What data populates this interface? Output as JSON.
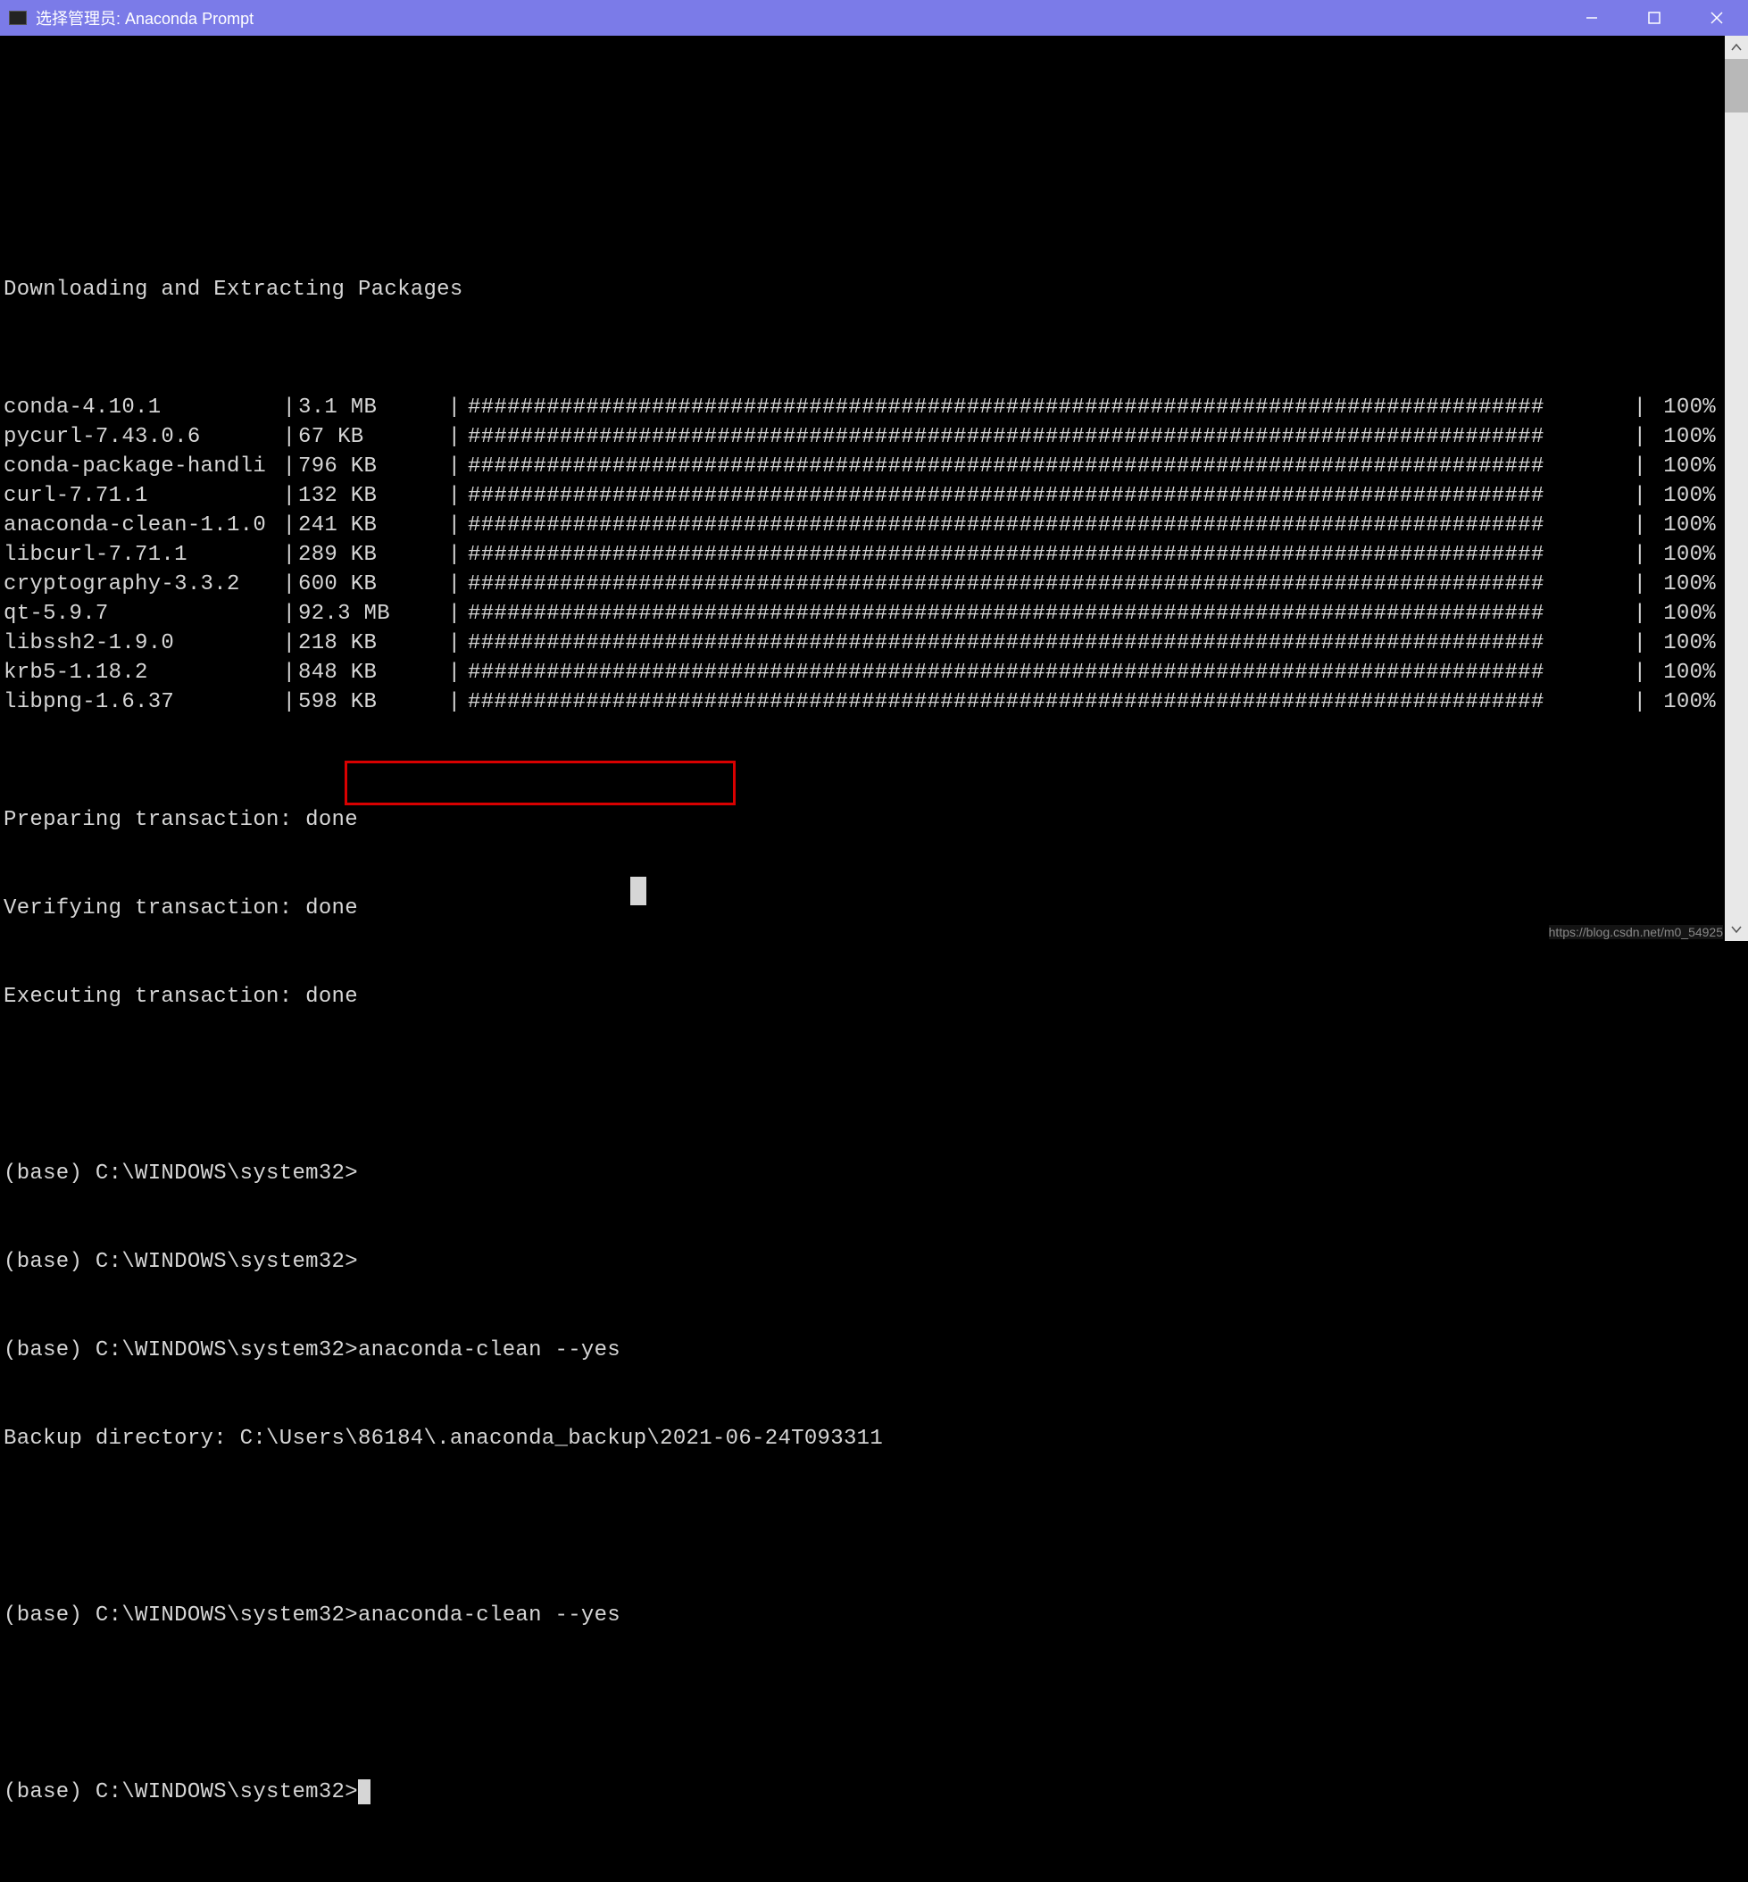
{
  "window": {
    "title": "选择管理员: Anaconda Prompt"
  },
  "header": "Downloading and Extracting Packages",
  "packages": [
    {
      "name": "conda-4.10.1",
      "size": "3.1 MB",
      "pct": "100%"
    },
    {
      "name": "pycurl-7.43.0.6",
      "size": "67 KB",
      "pct": "100%"
    },
    {
      "name": "conda-package-handli",
      "size": "796 KB",
      "pct": "100%"
    },
    {
      "name": "curl-7.71.1",
      "size": "132 KB",
      "pct": "100%"
    },
    {
      "name": "anaconda-clean-1.1.0",
      "size": "241 KB",
      "pct": "100%"
    },
    {
      "name": "libcurl-7.71.1",
      "size": "289 KB",
      "pct": "100%"
    },
    {
      "name": "cryptography-3.3.2",
      "size": "600 KB",
      "pct": "100%"
    },
    {
      "name": "qt-5.9.7",
      "size": "92.3 MB",
      "pct": "100%"
    },
    {
      "name": "libssh2-1.9.0",
      "size": "218 KB",
      "pct": "100%"
    },
    {
      "name": "krb5-1.18.2",
      "size": "848 KB",
      "pct": "100%"
    },
    {
      "name": "libpng-1.6.37",
      "size": "598 KB",
      "pct": "100%"
    }
  ],
  "bar_fill": "##################################################################################",
  "transactions": {
    "preparing": "Preparing transaction: done",
    "verifying": "Verifying transaction: done",
    "executing": "Executing transaction: done"
  },
  "prompts": {
    "p1": "(base) C:\\WINDOWS\\system32>",
    "p2": "(base) C:\\WINDOWS\\system32>",
    "p3": "(base) C:\\WINDOWS\\system32>anaconda-clean --yes",
    "backup": "Backup directory: C:\\Users\\86184\\.anaconda_backup\\2021-06-24T093311",
    "p4": "(base) C:\\WINDOWS\\system32>anaconda-clean --yes",
    "p5": "(base) C:\\WINDOWS\\system32>"
  },
  "watermark": "https://blog.csdn.net/m0_54925"
}
